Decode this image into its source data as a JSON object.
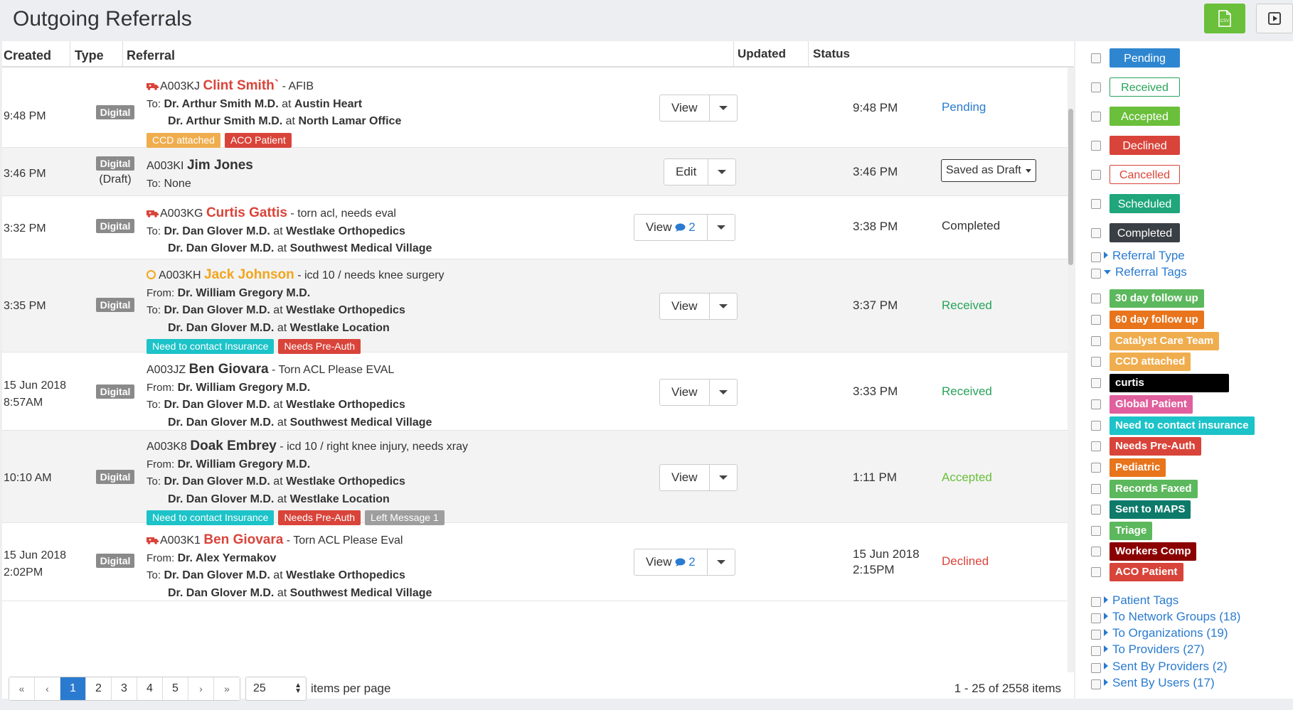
{
  "header": {
    "title": "Outgoing Referrals",
    "export_icon": "csv-file-icon",
    "present_icon": "play-icon"
  },
  "columns": {
    "created": "Created",
    "type": "Type",
    "referral": "Referral",
    "updated": "Updated",
    "status": "Status"
  },
  "rows": [
    {
      "created": "9:48 PM",
      "type": "Digital",
      "code": "A003KJ",
      "patient": "Clint Smith`",
      "note": "- AFIB",
      "lines": [
        {
          "prefix": "To:",
          "doctor": "Dr. Arthur Smith M.D.",
          "at": "at",
          "location": "Austin Heart"
        },
        {
          "prefix": "",
          "doctor": "Dr. Arthur Smith M.D.",
          "at": "at",
          "location": "North Lamar Office"
        }
      ],
      "tags": [
        {
          "label": "CCD attached",
          "color": "#f0ad4e"
        },
        {
          "label": "ACO Patient",
          "color": "#d9443a"
        }
      ],
      "action": "View",
      "comments": "",
      "updated": "9:48 PM",
      "status": "Pending"
    },
    {
      "created": "3:46 PM",
      "type": "Digital",
      "type_sub": "(Draft)",
      "code": "A003KI",
      "patient": "Jim Jones",
      "note": "",
      "lines": [
        {
          "prefix": "To:",
          "doctor": "None",
          "at": "",
          "location": ""
        }
      ],
      "action": "Edit",
      "updated": "3:46 PM",
      "status": "Saved as Draft"
    },
    {
      "created": "3:32 PM",
      "type": "Digital",
      "code": "A003KG",
      "patient": "Curtis Gattis",
      "note": "- torn acl, needs eval",
      "lines": [
        {
          "prefix": "To:",
          "doctor": "Dr. Dan Glover M.D.",
          "at": "at",
          "location": "Westlake Orthopedics"
        },
        {
          "prefix": "",
          "doctor": "Dr. Dan Glover M.D.",
          "at": "at",
          "location": "Southwest Medical Village"
        }
      ],
      "action": "View",
      "comments": "2",
      "updated": "3:38 PM",
      "status": "Completed"
    },
    {
      "created": "3:35 PM",
      "type": "Digital",
      "code": "A003KH",
      "patient": "Jack Johnson",
      "note": "- icd 10 / needs knee surgery",
      "from": {
        "prefix": "From:",
        "doctor": "Dr. William Gregory M.D."
      },
      "lines": [
        {
          "prefix": "To:",
          "doctor": "Dr. Dan Glover M.D.",
          "at": "at",
          "location": "Westlake Orthopedics"
        },
        {
          "prefix": "",
          "doctor": "Dr. Dan Glover M.D.",
          "at": "at",
          "location": "Westlake Location"
        }
      ],
      "tags": [
        {
          "label": "Need to contact Insurance",
          "color": "#1cc3c8"
        },
        {
          "label": "Needs Pre-Auth",
          "color": "#d9443a"
        }
      ],
      "action": "View",
      "updated": "3:37 PM",
      "status": "Received"
    },
    {
      "created": "15 Jun 2018",
      "created2": "8:57AM",
      "type": "Digital",
      "code": "A003JZ",
      "patient": "Ben Giovara",
      "note": "- Torn ACL Please EVAL",
      "from": {
        "prefix": "From:",
        "doctor": "Dr. William Gregory M.D."
      },
      "lines": [
        {
          "prefix": "To:",
          "doctor": "Dr. Dan Glover M.D.",
          "at": "at",
          "location": "Westlake Orthopedics"
        },
        {
          "prefix": "",
          "doctor": "Dr. Dan Glover M.D.",
          "at": "at",
          "location": "Southwest Medical Village"
        }
      ],
      "action": "View",
      "updated": "3:33 PM",
      "status": "Received"
    },
    {
      "created": "10:10 AM",
      "type": "Digital",
      "code": "A003K8",
      "patient": "Doak Embrey",
      "note": "- icd 10 / right knee injury, needs xray",
      "from": {
        "prefix": "From:",
        "doctor": "Dr. William Gregory M.D."
      },
      "lines": [
        {
          "prefix": "To:",
          "doctor": "Dr. Dan Glover M.D.",
          "at": "at",
          "location": "Westlake Orthopedics"
        },
        {
          "prefix": "",
          "doctor": "Dr. Dan Glover M.D.",
          "at": "at",
          "location": "Westlake Location"
        }
      ],
      "tags": [
        {
          "label": "Need to contact Insurance",
          "color": "#1cc3c8"
        },
        {
          "label": "Needs Pre-Auth",
          "color": "#d9443a"
        },
        {
          "label": "Left Message 1",
          "color": "#9e9e9e"
        }
      ],
      "action": "View",
      "updated": "1:11 PM",
      "status": "Accepted"
    },
    {
      "created": "15 Jun 2018",
      "created2": "2:02PM",
      "type": "Digital",
      "code": "A003K1",
      "patient": "Ben Giovara",
      "note": "- Torn ACL Please Eval",
      "from": {
        "prefix": "From:",
        "doctor": "Dr. Alex Yermakov"
      },
      "lines": [
        {
          "prefix": "To:",
          "doctor": "Dr. Dan Glover M.D.",
          "at": "at",
          "location": "Westlake Orthopedics"
        },
        {
          "prefix": "",
          "doctor": "Dr. Dan Glover M.D.",
          "at": "at",
          "location": "Southwest Medical Village"
        }
      ],
      "action": "View",
      "comments": "2",
      "updated": "15 Jun 2018",
      "updated2": "2:15PM",
      "status": "Declined"
    }
  ],
  "pagination": {
    "first": "«",
    "prev": "‹",
    "pages": [
      "1",
      "2",
      "3",
      "4",
      "5"
    ],
    "next": "›",
    "last": "»",
    "per_page": "25",
    "per_page_label": "items per page",
    "summary": "1 - 25 of 2558 items"
  },
  "sidebar": {
    "statuses": [
      {
        "label": "Pending",
        "bg": "#2f86d0",
        "fg": "#ffffff",
        "border": "#2f86d0"
      },
      {
        "label": "Received",
        "bg": "#ffffff",
        "fg": "#27a35a",
        "border": "#27a35a"
      },
      {
        "label": "Accepted",
        "bg": "#6abf3b",
        "fg": "#ffffff",
        "border": "#6abf3b"
      },
      {
        "label": "Declined",
        "bg": "#d9443a",
        "fg": "#ffffff",
        "border": "#d9443a"
      },
      {
        "label": "Cancelled",
        "bg": "#ffffff",
        "fg": "#d9443a",
        "border": "#d9443a"
      },
      {
        "label": "Scheduled",
        "bg": "#1fa67a",
        "fg": "#ffffff",
        "border": "#1fa67a"
      },
      {
        "label": "Completed",
        "bg": "#3a3f45",
        "fg": "#ffffff",
        "border": "#3a3f45"
      }
    ],
    "referral_type": "Referral Type",
    "referral_tags": "Referral Tags",
    "tags": [
      {
        "label": "30 day follow up",
        "color": "#5cb85c"
      },
      {
        "label": "60 day follow up",
        "color": "#e8741c"
      },
      {
        "label": "Catalyst Care Team",
        "color": "#f0ad4e"
      },
      {
        "label": "CCD attached",
        "color": "#f0ad4e"
      },
      {
        "label": "curtis",
        "color": "#000000"
      },
      {
        "label": "Global Patient",
        "color": "#e0609e"
      },
      {
        "label": "Need to contact insurance",
        "color": "#1cc3c8"
      },
      {
        "label": "Needs Pre-Auth",
        "color": "#d9443a"
      },
      {
        "label": "Pediatric",
        "color": "#e8741c"
      },
      {
        "label": "Records Faxed",
        "color": "#5cb85c"
      },
      {
        "label": "Sent to MAPS",
        "color": "#0d7a6a"
      },
      {
        "label": "Triage",
        "color": "#5cb85c"
      },
      {
        "label": "Workers Comp",
        "color": "#8b0000"
      },
      {
        "label": "ACO Patient",
        "color": "#d9443a"
      }
    ],
    "groups": [
      "Patient Tags",
      "To Network Groups (18)",
      "To Organizations (19)",
      "To Providers (27)",
      "Sent By Providers (2)",
      "Sent By Users (17)"
    ]
  }
}
